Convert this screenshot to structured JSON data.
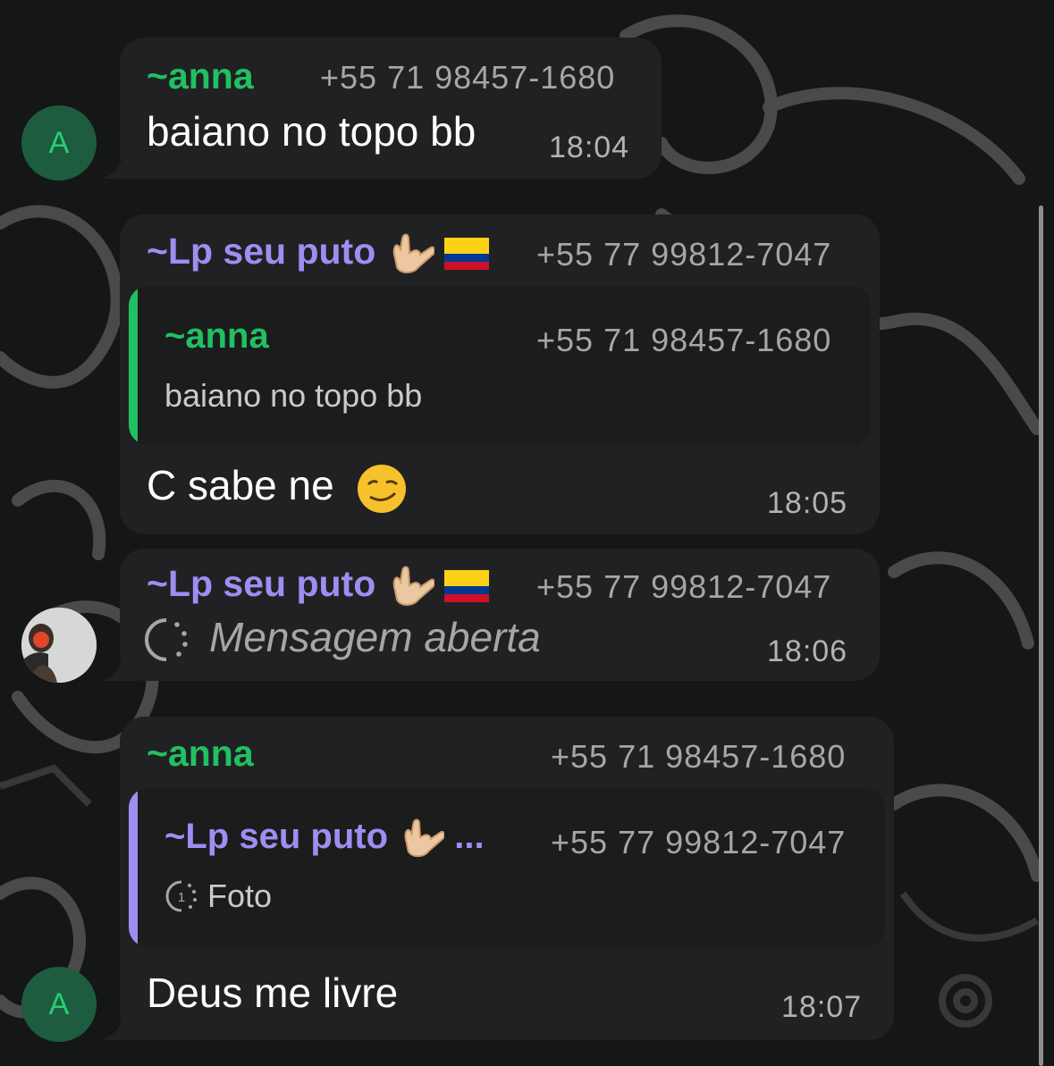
{
  "messages": [
    {
      "sender": "~anna",
      "phone": "+55 71 98457-1680",
      "text": "baiano no topo bb",
      "time": "18:04",
      "avatar_letter": "A"
    },
    {
      "sender": "~Lp seu puto",
      "phone": "+55 77 99812-7047",
      "quote": {
        "sender": "~anna",
        "phone": "+55 71 98457-1680",
        "text": "baiano no topo bb"
      },
      "text": "C sabe ne",
      "time": "18:05"
    },
    {
      "sender": "~Lp seu puto",
      "phone": "+55 77 99812-7047",
      "text": "Mensagem aberta",
      "time": "18:06"
    },
    {
      "sender": "~anna",
      "phone": "+55 71 98457-1680",
      "quote": {
        "sender": "~Lp seu puto",
        "sender_ellipsis": "...",
        "phone": "+55 77 99812-7047",
        "text": "Foto"
      },
      "text": "Deus me livre",
      "time": "18:07",
      "avatar_letter": "A"
    }
  ],
  "colors": {
    "anna": "#21c063",
    "lp": "#a08df2",
    "bubble": "#202122",
    "background": "#151616"
  },
  "icons": [
    "rock-on-hand-icon",
    "colombia-flag-icon",
    "smirk-emoji-icon",
    "view-once-icon",
    "view-once-photo-icon"
  ]
}
